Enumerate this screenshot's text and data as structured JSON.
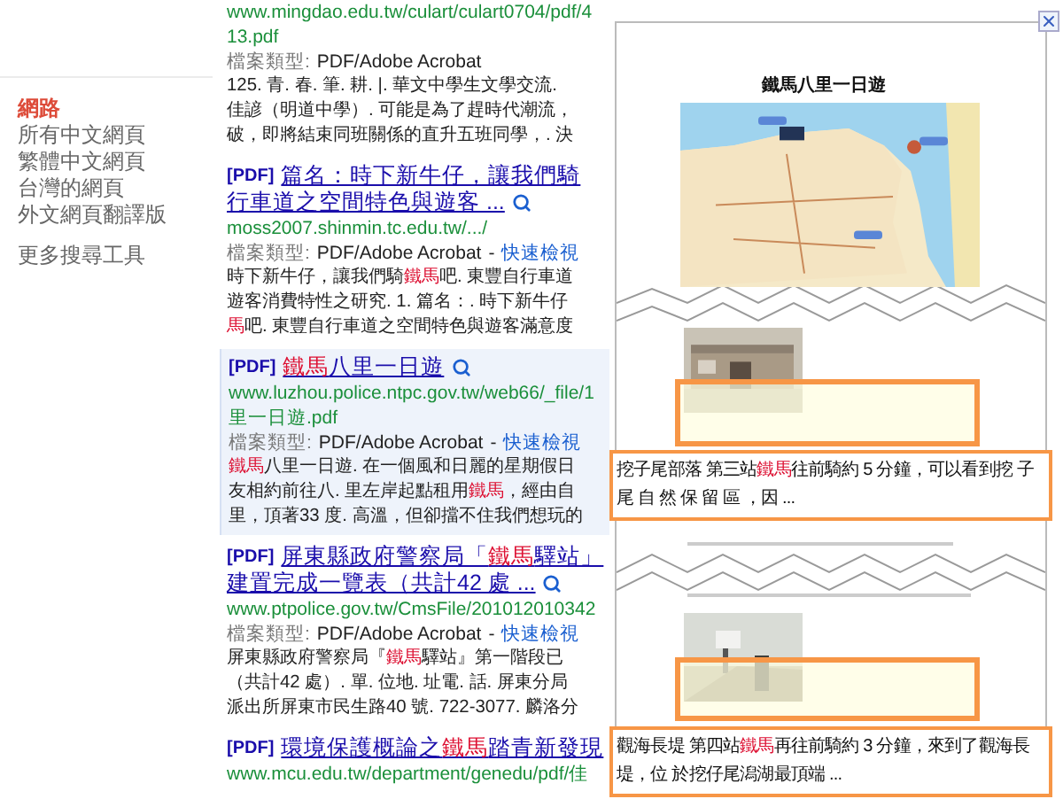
{
  "sidebar": {
    "items": [
      {
        "label": "網路",
        "selected": true
      },
      {
        "label": "所有中文網頁",
        "selected": false
      },
      {
        "label": "繁體中文網頁",
        "selected": false
      },
      {
        "label": "台灣的網頁",
        "selected": false
      },
      {
        "label": "外文網頁翻譯版",
        "selected": false
      }
    ],
    "more_tools": "更多搜尋工具"
  },
  "results": [
    {
      "selected": false,
      "url_lines": [
        "www.mingdao.edu.tw/culart/culart0704/pdf/4",
        "13.pdf"
      ],
      "file_type": {
        "label": "檔案類型:",
        "value": "PDF/Adobe Acrobat"
      },
      "snippet_lines": [
        [
          {
            "t": "125. 青. 春. 筆. 耕. |. 華文中學生文學交流.",
            "hl": false
          }
        ],
        [
          {
            "t": "佳諺（明道中學）. 可能是為了趕時代潮流，",
            "hl": false
          }
        ],
        [
          {
            "t": "破，即將結束同班關係的直升五班同學，. 決",
            "hl": false
          }
        ]
      ]
    },
    {
      "selected": false,
      "tag": "[PDF]",
      "title_lines": [
        [
          {
            "t": "篇名：時下新牛仔，讓我們騎",
            "hl": false
          }
        ],
        [
          {
            "t": "行車道之空間特色與遊客 ...",
            "hl": false
          }
        ]
      ],
      "url_lines": [
        "moss2007.shinmin.tc.edu.tw/.../"
      ],
      "file_type": {
        "label": "檔案類型:",
        "value": "PDF/Adobe Acrobat",
        "separator": "-",
        "quick_view": "快速檢視"
      },
      "snippet_lines": [
        [
          {
            "t": "時下新牛仔，讓我們騎",
            "hl": false
          },
          {
            "t": "鐵馬",
            "hl": true
          },
          {
            "t": "吧. 東豐自行車道",
            "hl": false
          }
        ],
        [
          {
            "t": "遊客消費特性之研究. 1. 篇名：. 時下新牛仔",
            "hl": false
          }
        ],
        [
          {
            "t": "馬",
            "hl": true
          },
          {
            "t": "吧. 東豐自行車道之空間特色與遊客滿意度",
            "hl": false
          }
        ]
      ]
    },
    {
      "selected": true,
      "tag": "[PDF]",
      "title_lines": [
        [
          {
            "t": "鐵馬",
            "hl": true
          },
          {
            "t": "八里一日遊",
            "hl": false
          }
        ]
      ],
      "url_lines": [
        "www.luzhou.police.ntpc.gov.tw/web66/_file/1",
        "里一日遊.pdf"
      ],
      "file_type": {
        "label": "檔案類型:",
        "value": "PDF/Adobe Acrobat",
        "separator": "-",
        "quick_view": "快速檢視"
      },
      "snippet_lines": [
        [
          {
            "t": "鐵馬",
            "hl": true
          },
          {
            "t": "八里一日遊. 在一個風和日麗的星期假日",
            "hl": false
          }
        ],
        [
          {
            "t": "友相約前往八. 里左岸起點租用",
            "hl": false
          },
          {
            "t": "鐵馬",
            "hl": true
          },
          {
            "t": "，經由自",
            "hl": false
          }
        ],
        [
          {
            "t": "里，頂著33 度. 高溫，但卻擋不住我們想玩的",
            "hl": false
          }
        ]
      ]
    },
    {
      "selected": false,
      "tag": "[PDF]",
      "title_lines": [
        [
          {
            "t": "屏東縣政府警察局「",
            "hl": false
          },
          {
            "t": "鐵馬",
            "hl": true
          },
          {
            "t": "驛站」",
            "hl": false
          }
        ],
        [
          {
            "t": "建置完成一覽表（共計42 處 ...",
            "hl": false
          }
        ]
      ],
      "url_lines": [
        "www.ptpolice.gov.tw/CmsFile/201012010342"
      ],
      "file_type": {
        "label": "檔案類型:",
        "value": "PDF/Adobe Acrobat",
        "separator": "-",
        "quick_view": "快速檢視"
      },
      "snippet_lines": [
        [
          {
            "t": "屏東縣政府警察局『",
            "hl": false
          },
          {
            "t": "鐵馬",
            "hl": true
          },
          {
            "t": "驛站』第一階段已",
            "hl": false
          }
        ],
        [
          {
            "t": "（共計42 處）. 單. 位地. 址電. 話. 屏東分局",
            "hl": false
          }
        ],
        [
          {
            "t": "派出所屏東市民生路40 號. 722-3077. 麟洛分",
            "hl": false
          }
        ]
      ]
    },
    {
      "selected": false,
      "tag": "[PDF]",
      "title_lines": [
        [
          {
            "t": "環境保護概論之",
            "hl": false
          },
          {
            "t": "鐵馬",
            "hl": true
          },
          {
            "t": "踏青新發現",
            "hl": false
          }
        ]
      ],
      "url_lines": [
        "www.mcu.edu.tw/department/genedu/pdf/佳"
      ]
    }
  ],
  "preview": {
    "doc_title": "鐵馬八里一日遊",
    "callouts": [
      [
        {
          "t": "挖子尾部落 第三站",
          "hl": false
        },
        {
          "t": "鐵馬",
          "hl": true
        },
        {
          "t": "往前騎約 5 分鐘，可以看到挖 子尾 自 然 保 留 區 ，因 ...",
          "hl": false
        }
      ],
      [
        {
          "t": "觀海長堤 第四站",
          "hl": false
        },
        {
          "t": "鐵馬",
          "hl": true
        },
        {
          "t": "再往前騎約 3 分鐘，來到了觀海長堤，位 於挖仔尾潟湖最頂端 ...",
          "hl": false
        }
      ]
    ]
  }
}
